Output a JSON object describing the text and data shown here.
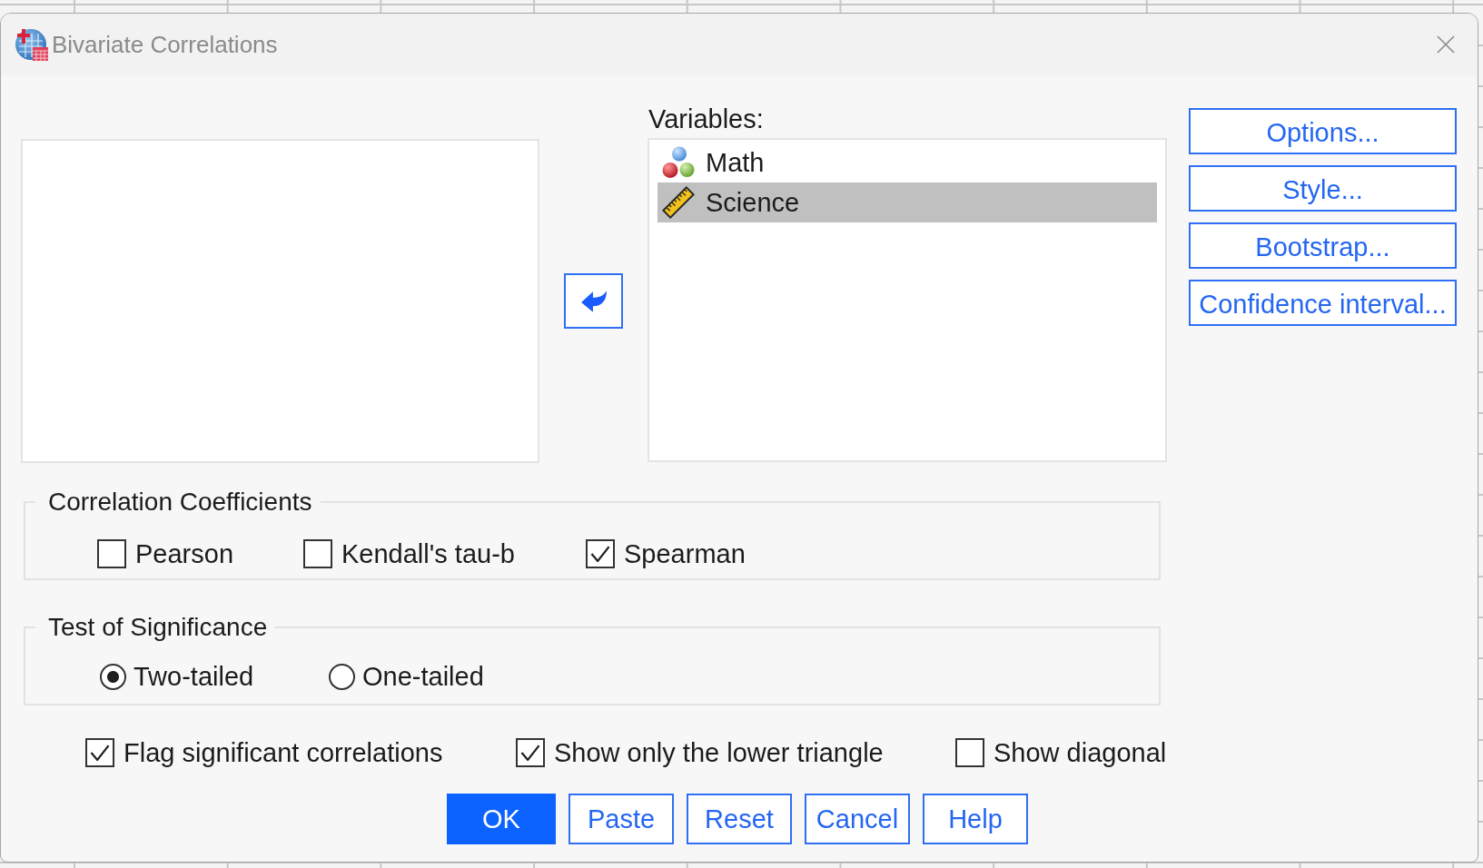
{
  "window": {
    "title": "Bivariate Correlations"
  },
  "variables": {
    "label": "Variables:",
    "items": [
      {
        "name": "Math",
        "kind": "nominal",
        "selected": false
      },
      {
        "name": "Science",
        "kind": "scale",
        "selected": true
      }
    ]
  },
  "side_buttons": [
    {
      "label": "Options..."
    },
    {
      "label": "Style..."
    },
    {
      "label": "Bootstrap..."
    },
    {
      "label": "Confidence interval..."
    }
  ],
  "correlation_coefficients": {
    "title": "Correlation Coefficients",
    "options": [
      {
        "label": "Pearson",
        "checked": false
      },
      {
        "label": "Kendall's tau-b",
        "checked": false
      },
      {
        "label": "Spearman",
        "checked": true
      }
    ]
  },
  "test_of_significance": {
    "title": "Test of Significance",
    "options": [
      {
        "label": "Two-tailed",
        "selected": true
      },
      {
        "label": "One-tailed",
        "selected": false
      }
    ]
  },
  "display_options": [
    {
      "label": "Flag significant correlations",
      "checked": true
    },
    {
      "label": "Show only the lower triangle",
      "checked": true
    },
    {
      "label": "Show diagonal",
      "checked": false
    }
  ],
  "buttons": [
    {
      "label": "OK",
      "default": true
    },
    {
      "label": "Paste",
      "default": false
    },
    {
      "label": "Reset",
      "default": false
    },
    {
      "label": "Cancel",
      "default": false
    },
    {
      "label": "Help",
      "default": false
    }
  ]
}
